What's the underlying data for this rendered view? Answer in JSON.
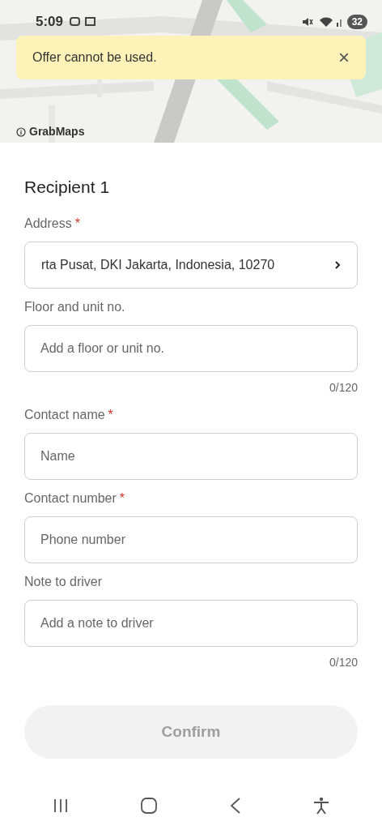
{
  "status_bar": {
    "time": "5:09",
    "battery": "32"
  },
  "map": {
    "attribution": "GrabMaps"
  },
  "toast": {
    "message": "Offer cannot be used.",
    "close": "×"
  },
  "form": {
    "title": "Recipient 1",
    "fields": [
      {
        "kind": "select",
        "label": "Address",
        "required_mark": "*",
        "value": "rta Pusat, DKI Jakarta, Indonesia, 10270"
      },
      {
        "kind": "input",
        "label": "Floor and unit no.",
        "placeholder": "Add a floor or unit no.",
        "counter": "0/120"
      },
      {
        "kind": "input",
        "label": "Contact name",
        "required_mark": "*",
        "placeholder": "Name"
      },
      {
        "kind": "input",
        "label": "Contact number",
        "required_mark": "*",
        "placeholder": "Phone number"
      },
      {
        "kind": "input",
        "label": "Note to driver",
        "placeholder": "Add a note to driver",
        "counter": "0/120"
      }
    ]
  },
  "confirm": {
    "label": "Confirm",
    "disabled": true
  }
}
